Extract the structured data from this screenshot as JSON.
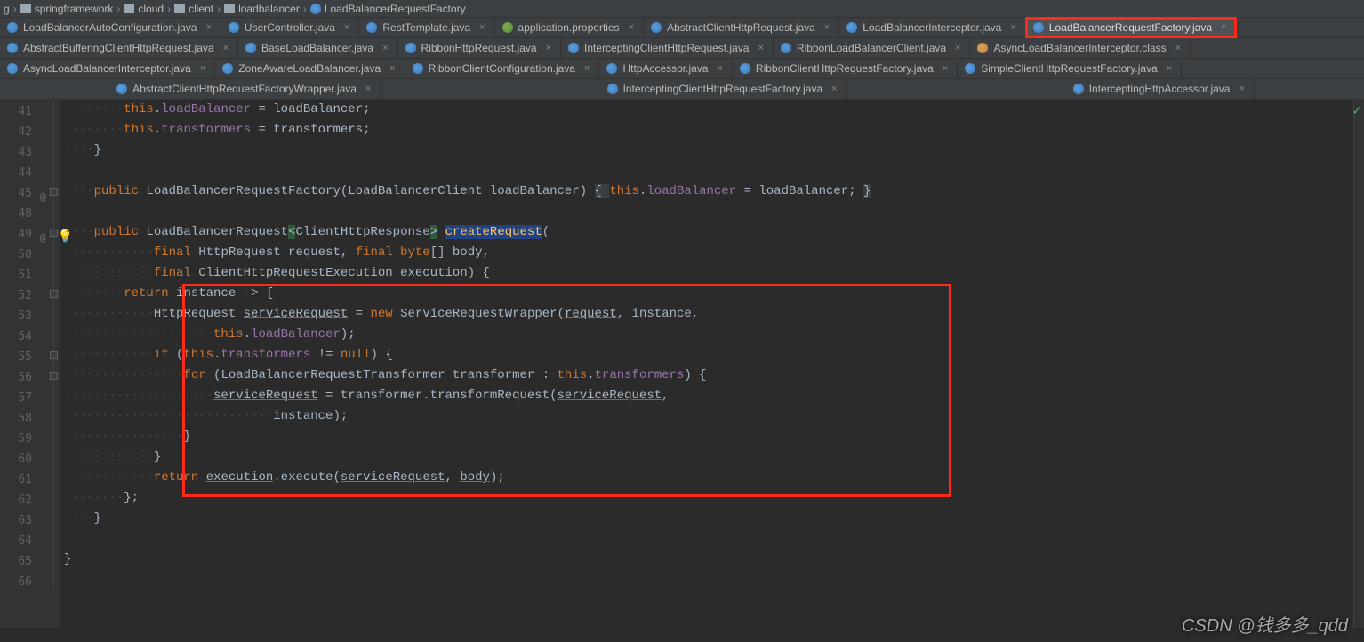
{
  "breadcrumb": [
    "g",
    "springframework",
    "cloud",
    "client",
    "loadbalancer",
    "LoadBalancerRequestFactory"
  ],
  "tabs": {
    "row1": [
      {
        "label": "LoadBalancerAutoConfiguration.java",
        "icon": "java"
      },
      {
        "label": "UserController.java",
        "icon": "java"
      },
      {
        "label": "RestTemplate.java",
        "icon": "java"
      },
      {
        "label": "application.properties",
        "icon": "green"
      },
      {
        "label": "AbstractClientHttpRequest.java",
        "icon": "java"
      },
      {
        "label": "LoadBalancerInterceptor.java",
        "icon": "java"
      },
      {
        "label": "LoadBalancerRequestFactory.java",
        "icon": "java",
        "active": true,
        "redbox": true
      }
    ],
    "row2": [
      {
        "label": "AbstractBufferingClientHttpRequest.java",
        "icon": "java"
      },
      {
        "label": "BaseLoadBalancer.java",
        "icon": "java"
      },
      {
        "label": "RibbonHttpRequest.java",
        "icon": "java"
      },
      {
        "label": "InterceptingClientHttpRequest.java",
        "icon": "java"
      },
      {
        "label": "RibbonLoadBalancerClient.java",
        "icon": "java"
      },
      {
        "label": "AsyncLoadBalancerInterceptor.class",
        "icon": "orange"
      }
    ],
    "row3": [
      {
        "label": "AsyncLoadBalancerInterceptor.java",
        "icon": "java"
      },
      {
        "label": "ZoneAwareLoadBalancer.java",
        "icon": "java"
      },
      {
        "label": "RibbonClientConfiguration.java",
        "icon": "java"
      },
      {
        "label": "HttpAccessor.java",
        "icon": "java"
      },
      {
        "label": "RibbonClientHttpRequestFactory.java",
        "icon": "java"
      },
      {
        "label": "SimpleClientHttpRequestFactory.java",
        "icon": "java"
      }
    ],
    "row4": [
      {
        "label": "AbstractClientHttpRequestFactoryWrapper.java",
        "icon": "java"
      },
      {
        "label": "InterceptingClientHttpRequestFactory.java",
        "icon": "java"
      },
      {
        "label": "InterceptingHttpAccessor.java",
        "icon": "java"
      }
    ]
  },
  "lines": [
    41,
    42,
    43,
    44,
    45,
    48,
    49,
    50,
    51,
    52,
    53,
    54,
    55,
    56,
    57,
    58,
    59,
    60,
    61,
    62,
    63,
    64,
    65,
    66
  ],
  "code": {
    "l41": "        this.loadBalancer = loadBalancer;",
    "l42": "        this.transformers = transformers;",
    "l43": "    }",
    "l44": "",
    "l45_pre": "    public ",
    "l45_ctor": "LoadBalancerRequestFactory",
    "l45_params": "(LoadBalancerClient loadBalancer) ",
    "l45_body1": "{ ",
    "l45_body2": "this",
    "l45_body3": ".loadBalancer = loadBalancer; ",
    "l45_body4": "}",
    "l48": "",
    "l49_pre": "    public ",
    "l49_ty": "LoadBalancerRequest",
    "l49_gen1": "<",
    "l49_gen2": "ClientHttpResponse",
    "l49_gen3": "> ",
    "l49_mn": "createRequest",
    "l49_paren": "(",
    "l50_pre": "            ",
    "l50_kw": "final",
    "l50_rest": " HttpRequest request, ",
    "l50_kw2": "final byte",
    "l50_rest2": "[] body,",
    "l51_pre": "            ",
    "l51_kw": "final",
    "l51_rest": " ClientHttpRequestExecution execution) {",
    "l52_pre": "        ",
    "l52_kw": "return",
    "l52_rest": " instance -> {",
    "l53_pre": "            HttpRequest ",
    "l53_un": "serviceRequest",
    "l53_mid": " = ",
    "l53_kw": "new",
    "l53_rest": " ServiceRequestWrapper(",
    "l53_un2": "request",
    "l53_rest2": ", instance,",
    "l54_pre": "                    ",
    "l54_kw": "this",
    "l54_rest": ".loadBalancer);",
    "l55_pre": "            ",
    "l55_kw": "if",
    "l55_paren": " (",
    "l55_kw2": "this",
    "l55_rest": ".transformers != ",
    "l55_kw3": "null",
    "l55_rest2": ") {",
    "l56_pre": "                ",
    "l56_kw": "for",
    "l56_rest": " (LoadBalancerRequestTransformer transformer : ",
    "l56_kw2": "this",
    "l56_rest2": ".transformers) {",
    "l57_pre": "                    ",
    "l57_un": "serviceRequest",
    "l57_rest": " = transformer.transformRequest(",
    "l57_un2": "serviceRequest",
    "l57_rest2": ",",
    "l58_pre": "                            instance);",
    "l59": "                }",
    "l60": "            }",
    "l61_pre": "            ",
    "l61_kw": "return",
    "l61_sp": " ",
    "l61_un": "execution",
    "l61_rest": ".execute(",
    "l61_un2": "serviceRequest",
    "l61_rest2": ", ",
    "l61_un3": "body",
    "l61_rest3": ");",
    "l62": "        };",
    "l63": "    }",
    "l64": "",
    "l65": "}",
    "l66": ""
  },
  "watermark": "CSDN @钱多多_qdd"
}
